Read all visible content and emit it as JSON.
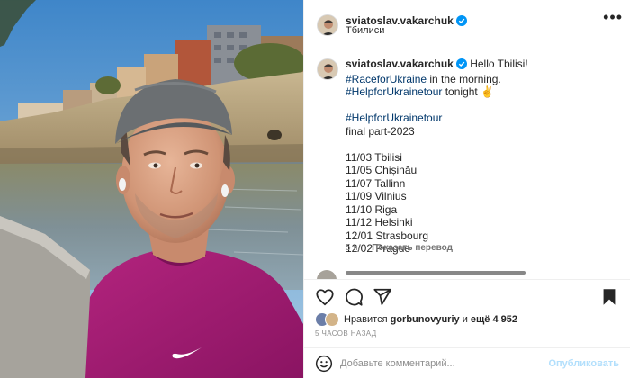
{
  "post": {
    "author": "sviatoslav.vakarchuk",
    "location": "Тбилиси",
    "caption": {
      "greeting": "Hello Tbilisi!",
      "tag1": "#RaceforUkraine",
      "text1": " in the morning.",
      "tag2": "#HelpforUkrainetour",
      "text2": " tonight ✌",
      "tag3": "#HelpforUkrainetour",
      "line_final": "final part-2023",
      "tour_dates": [
        "11/03 Tbilisi",
        "11/05 Chișinău",
        "11/07 Tallinn",
        "11/09 Vilnius",
        "11/10 Riga",
        "11/12 Helsinki",
        "12/01 Strasbourg",
        "12/02 Prague"
      ]
    },
    "time_short": "5 ч.",
    "show_translation": "Показать перевод",
    "likes": {
      "prefix": "Нравится",
      "user": "gorbunovyuriy",
      "connector": "и",
      "others": "ещё 4 952"
    },
    "time_ago": "5 ЧАСОВ НАЗАД",
    "comment": {
      "placeholder": "Добавьте комментарий...",
      "publish": "Опубликовать"
    }
  },
  "icons": {
    "verified": "verified-badge-icon",
    "more": "more-options-icon",
    "like": "heart-icon",
    "comment": "comment-icon",
    "share": "paper-plane-icon",
    "save": "bookmark-icon",
    "emoji": "emoji-icon"
  },
  "colors": {
    "hashtag": "#00376b",
    "verified": "#0095f6",
    "muted": "#8e8e8e",
    "publish_disabled": "#b2dffc",
    "shirt": "#a01870"
  }
}
